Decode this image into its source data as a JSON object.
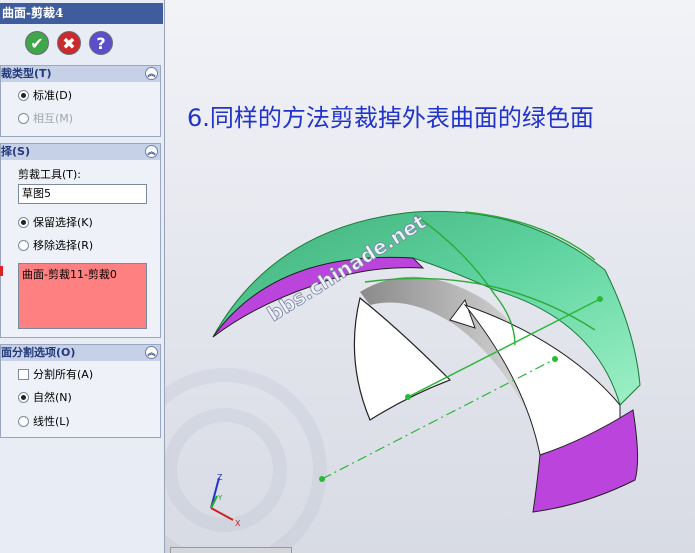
{
  "panel": {
    "title": "曲面-剪裁4",
    "buttons": {
      "ok": "✔",
      "cancel": "✖",
      "help": "?"
    },
    "trim_type": {
      "header": "裁类型(T)",
      "options": [
        "标准(D)",
        "相互(M)"
      ]
    },
    "selections": {
      "header": "择(S)",
      "tool_label": "剪裁工具(T):",
      "tool_value": "草图5",
      "keep_option": "保留选择(K)",
      "remove_option": "移除选择(R)",
      "list_value": "曲面-剪裁11-剪裁0"
    },
    "split": {
      "header": "面分割选项(O)",
      "split_all": "分割所有(A)",
      "natural": "自然(N)",
      "linear": "线性(L)"
    }
  },
  "viewport": {
    "caption": "6.同样的方法剪裁掉外表曲面的绿色面",
    "watermark": "bbs.chinade.net",
    "triad": {
      "x": "X",
      "y": "Y",
      "z": "Z"
    }
  },
  "colors": {
    "caption": "#2233cc",
    "green_surface": "#66d9a3",
    "magenta_surface": "#bb44dd",
    "highlight_list": "#ff8080"
  }
}
